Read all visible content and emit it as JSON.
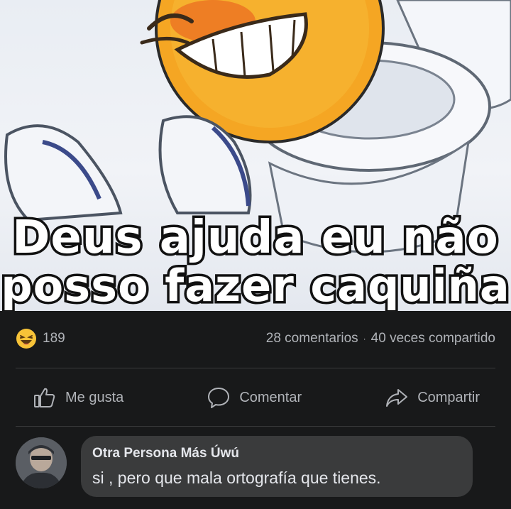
{
  "meme": {
    "caption_line1": "Deus ajuda eu não",
    "caption_line2": "posso fazer caquiña"
  },
  "stats": {
    "reaction_icon": "haha-emoji-icon",
    "reaction_count": "189",
    "comments": "28 comentarios",
    "separator": "·",
    "shares": "40 veces compartido"
  },
  "actions": {
    "like_label": "Me gusta",
    "comment_label": "Comentar",
    "share_label": "Compartir"
  },
  "comment": {
    "author": "Otra Persona Más Úwú",
    "text": "si , pero que mala ortografía que tienes."
  },
  "colors": {
    "background": "#18191a",
    "bubble": "#3a3b3c",
    "muted_text": "#b0b3b8",
    "text": "#e4e6eb"
  }
}
